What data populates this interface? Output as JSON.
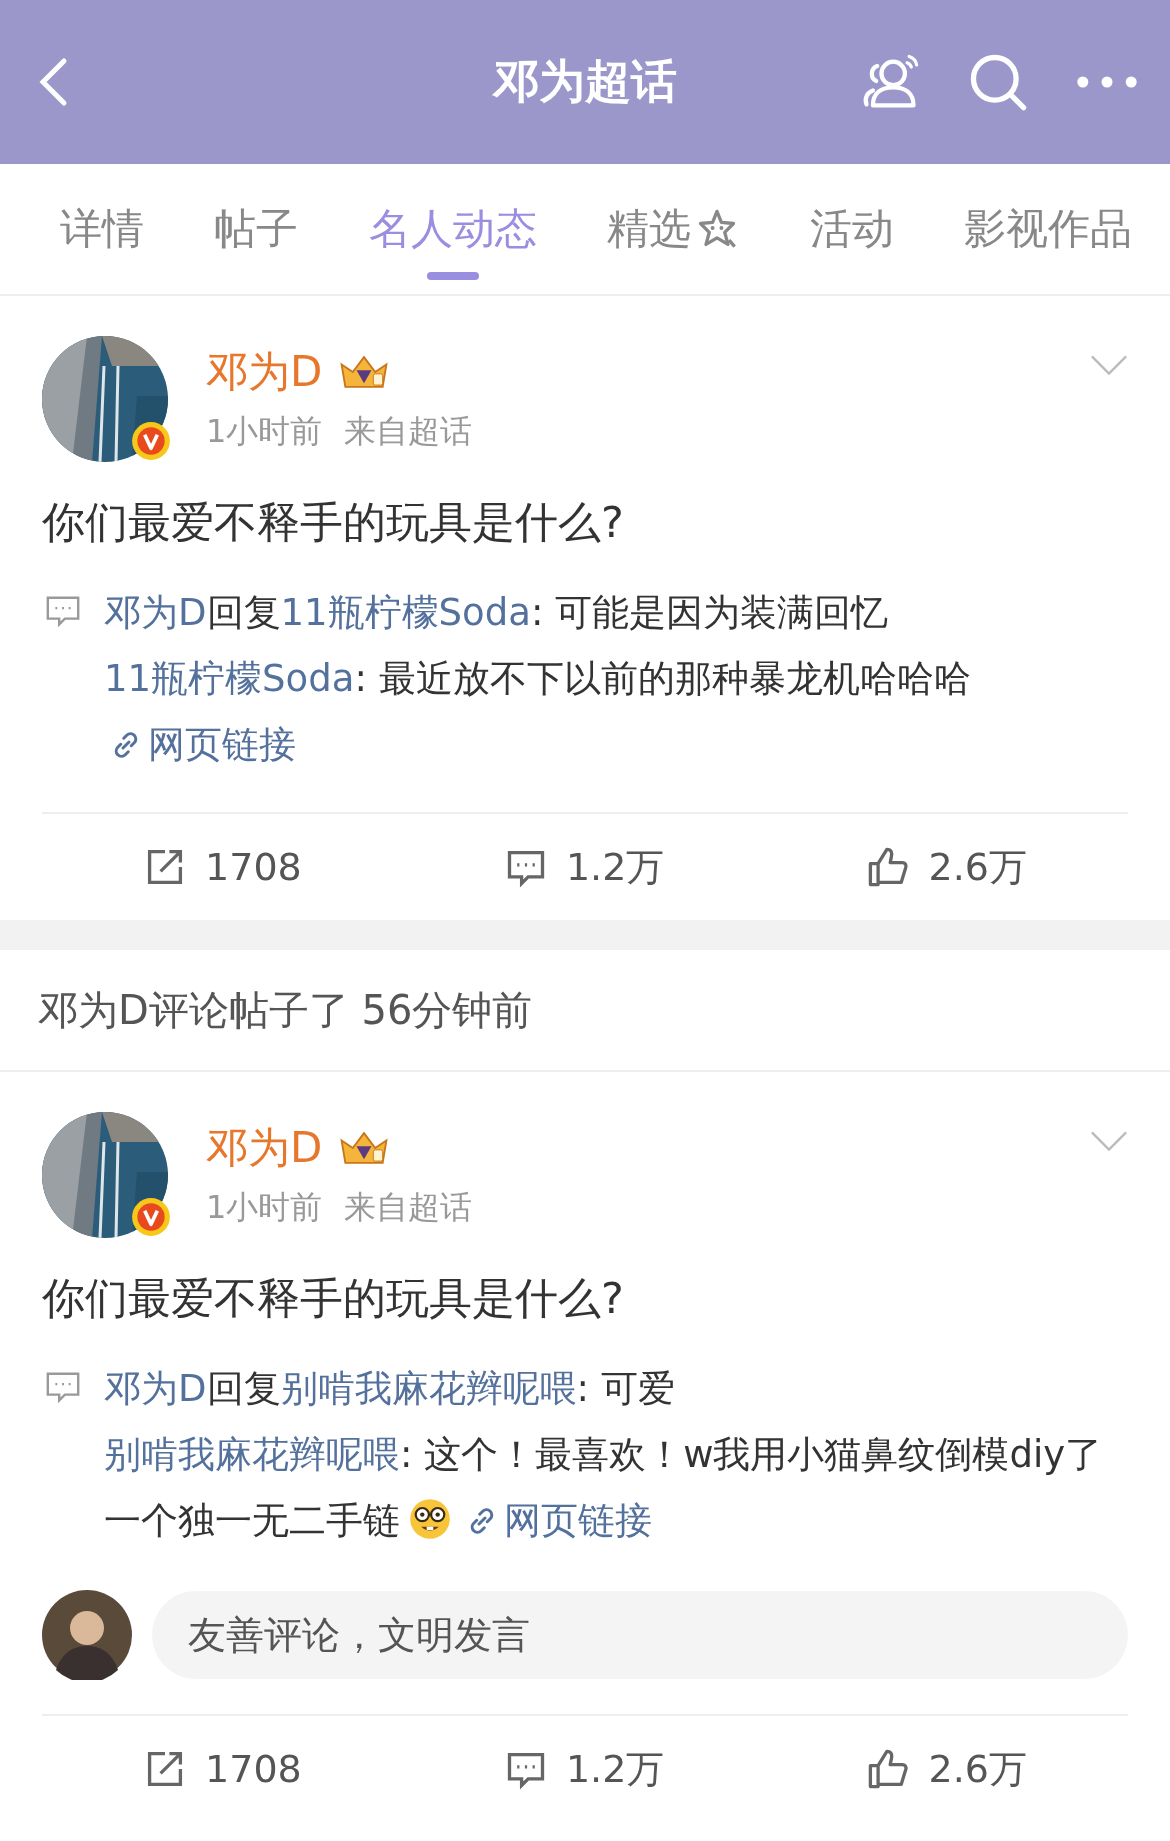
{
  "header": {
    "title": "邓为超话"
  },
  "tabs": [
    {
      "label": "详情",
      "selected": false,
      "kind": "plain"
    },
    {
      "label": "帖子",
      "selected": false,
      "kind": "plain"
    },
    {
      "label": "名人动态",
      "selected": true,
      "kind": "plain"
    },
    {
      "label": "精选",
      "selected": false,
      "kind": "star"
    },
    {
      "label": "活动",
      "selected": false,
      "kind": "plain"
    },
    {
      "label": "影视作品",
      "selected": false,
      "kind": "plain"
    }
  ],
  "feed": [
    {
      "kind": "post",
      "author": "邓为D",
      "time": "1小时前",
      "source": "来自超话",
      "text": "你们最爱不释手的玩具是什么?",
      "reply": [
        {
          "text": "邓为D",
          "kind": "user"
        },
        {
          "text": "回复",
          "kind": "plain"
        },
        {
          "text": "11瓶柠檬Soda",
          "kind": "user"
        },
        {
          "text": ": 可能是因为装满回忆",
          "kind": "plain"
        }
      ],
      "quote": [
        {
          "text": "11瓶柠檬Soda",
          "kind": "user"
        },
        {
          "text": ": 最近放不下以前的那种暴龙机哈哈哈",
          "kind": "plain"
        },
        {
          "text": "网页链接",
          "kind": "link"
        }
      ],
      "stats": {
        "shares": "1708",
        "comments": "1.2万",
        "likes": "2.6万"
      }
    },
    {
      "kind": "activity",
      "text": "邓为D评论帖子了 56分钟前"
    },
    {
      "kind": "post",
      "author": "邓为D",
      "time": "1小时前",
      "source": "来自超话",
      "text": "你们最爱不释手的玩具是什么?",
      "reply": [
        {
          "text": "邓为D",
          "kind": "user"
        },
        {
          "text": "回复",
          "kind": "plain"
        },
        {
          "text": "别啃我麻花辫呢喂",
          "kind": "user"
        },
        {
          "text": ": 可爱",
          "kind": "plain"
        }
      ],
      "quote": [
        {
          "text": "别啃我麻花辫呢喂",
          "kind": "user"
        },
        {
          "text": ": 这个！最喜欢！w我用小猫鼻纹倒模diy了一个独一无二手链",
          "kind": "plain"
        },
        {
          "kind": "emoji"
        },
        {
          "text": "网页链接",
          "kind": "link"
        }
      ],
      "comment_placeholder": "友善评论，文明发言",
      "stats": {
        "shares": "1708",
        "comments": "1.2万",
        "likes": "2.6万"
      }
    }
  ]
}
